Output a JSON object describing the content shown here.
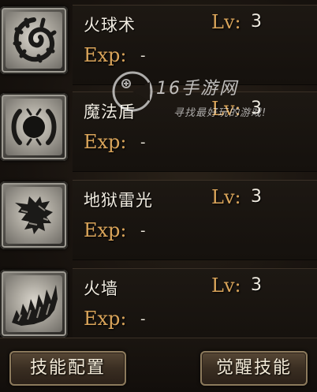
{
  "skills": [
    {
      "name": "火球术",
      "lv_label": "Lv:",
      "lv_value": "3",
      "exp_label": "Exp:",
      "exp_value": "-",
      "icon": "fire-swirl-icon"
    },
    {
      "name": "魔法盾",
      "lv_label": "Lv:",
      "lv_value": "3",
      "exp_label": "Exp:",
      "exp_value": "-",
      "icon": "magic-shield-icon"
    },
    {
      "name": "地狱雷光",
      "lv_label": "Lv:",
      "lv_value": "3",
      "exp_label": "Exp:",
      "exp_value": "-",
      "icon": "hell-lightning-icon"
    },
    {
      "name": "火墙",
      "lv_label": "Lv:",
      "lv_value": "3",
      "exp_label": "Exp:",
      "exp_value": "-",
      "icon": "fire-wall-icon"
    }
  ],
  "buttons": {
    "skill_config": "技能配置",
    "awaken_skill": "觉醒技能"
  },
  "watermark": {
    "title": "16手游网",
    "subtitle": "寻找最好玩的游戏!"
  },
  "colors": {
    "label_gold": "#d9a45a",
    "text_light": "#f0ebe0",
    "background": "#17130f"
  }
}
